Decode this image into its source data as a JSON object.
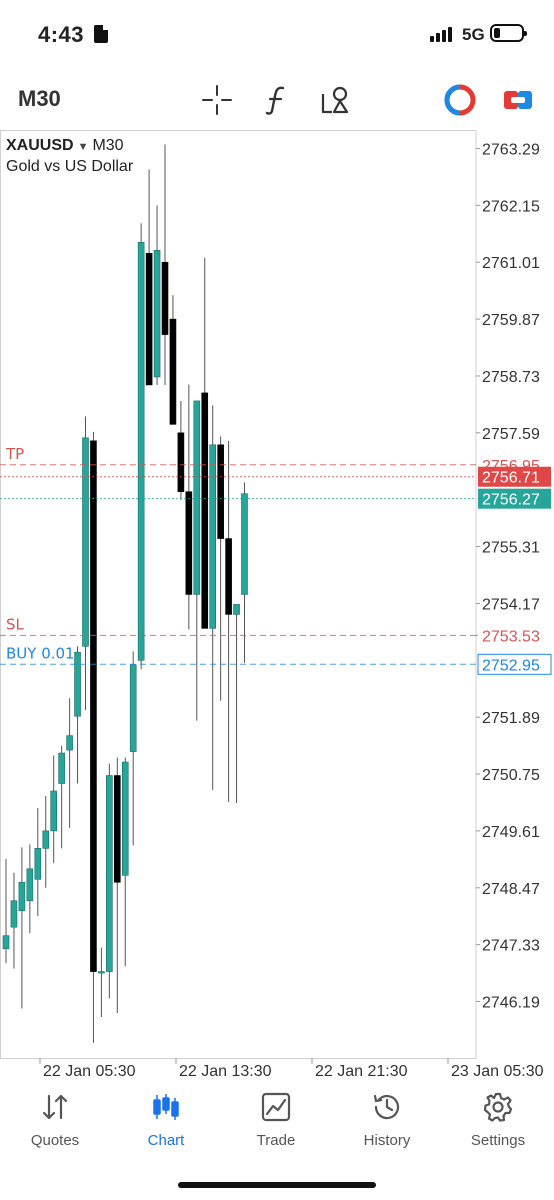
{
  "status_bar": {
    "time": "4:43",
    "network": "5G"
  },
  "toolbar": {
    "timeframe": "M30",
    "icons": [
      "crosshair-icon",
      "function-icon",
      "objects-icon",
      "one-click-trading-icon",
      "trade-panel-icon"
    ]
  },
  "chart": {
    "symbol": "XAUUSD",
    "timeframe": "M30",
    "description": "Gold vs US Dollar",
    "price_levels": [
      {
        "label": "TP",
        "price": "2756.95",
        "color": "#d9534f"
      },
      {
        "label": "",
        "price": "2756.71",
        "color": "#e04848"
      },
      {
        "label": "",
        "price": "2756.27",
        "color": "#26a69a"
      },
      {
        "label": "SL",
        "price": "2753.53",
        "color": "#d9534f"
      },
      {
        "label": "BUY 0.01",
        "price": "2752.95",
        "color": "#1e88e5"
      }
    ],
    "colors": {
      "bull": "#26a69a",
      "bear": "#000000",
      "tp_sl": "#d9534f",
      "bid": "#e04848",
      "ask": "#26a69a",
      "buy": "#1e88e5"
    }
  },
  "chart_data": {
    "type": "candlestick",
    "title": "XAUUSD M30",
    "subtitle": "Gold vs US Dollar",
    "y_ticks": [
      2763.29,
      2762.15,
      2761.01,
      2759.87,
      2758.73,
      2757.59,
      2755.31,
      2754.17,
      2753.53,
      2751.89,
      2750.75,
      2749.61,
      2748.47,
      2747.33,
      2746.19
    ],
    "y_tick_labels": [
      "2763.29",
      "2762.15",
      "2761.01",
      "2759.87",
      "2758.73",
      "2757.59",
      "2755.31",
      "2754.17",
      "2753.53",
      "2751.89",
      "2750.75",
      "2749.61",
      "2748.47",
      "2747.33",
      "2746.19"
    ],
    "ylim": [
      2745.25,
      2763.5
    ],
    "x_tick_labels": [
      "22 Jan 05:30",
      "22 Jan 13:30",
      "22 Jan 21:30",
      "23 Jan 05:30"
    ],
    "candles": [
      {
        "o": 2747.25,
        "h": 2749.05,
        "l": 2746.96,
        "c": 2747.51
      },
      {
        "o": 2747.68,
        "h": 2748.77,
        "l": 2746.85,
        "c": 2748.21
      },
      {
        "o": 2748.01,
        "h": 2749.28,
        "l": 2746.05,
        "c": 2748.58
      },
      {
        "o": 2748.21,
        "h": 2749.34,
        "l": 2747.56,
        "c": 2748.85
      },
      {
        "o": 2748.64,
        "h": 2750.07,
        "l": 2747.9,
        "c": 2749.26
      },
      {
        "o": 2749.26,
        "h": 2750.31,
        "l": 2748.47,
        "c": 2749.61
      },
      {
        "o": 2749.61,
        "h": 2751.12,
        "l": 2748.96,
        "c": 2750.41
      },
      {
        "o": 2750.56,
        "h": 2751.32,
        "l": 2749.26,
        "c": 2751.17
      },
      {
        "o": 2751.23,
        "h": 2752.27,
        "l": 2749.67,
        "c": 2751.52
      },
      {
        "o": 2751.91,
        "h": 2753.31,
        "l": 2750.56,
        "c": 2753.19
      },
      {
        "o": 2753.31,
        "h": 2757.92,
        "l": 2752.03,
        "c": 2757.49
      },
      {
        "o": 2757.43,
        "h": 2757.61,
        "l": 2745.36,
        "c": 2746.79
      },
      {
        "o": 2746.79,
        "h": 2747.27,
        "l": 2745.88,
        "c": 2746.79
      },
      {
        "o": 2746.79,
        "h": 2750.96,
        "l": 2746.25,
        "c": 2750.72
      },
      {
        "o": 2750.72,
        "h": 2751.08,
        "l": 2745.96,
        "c": 2748.58
      },
      {
        "o": 2748.72,
        "h": 2751.08,
        "l": 2746.9,
        "c": 2750.99
      },
      {
        "o": 2751.2,
        "h": 2753.21,
        "l": 2749.32,
        "c": 2752.94
      },
      {
        "o": 2753.03,
        "h": 2761.79,
        "l": 2752.85,
        "c": 2761.41
      },
      {
        "o": 2761.19,
        "h": 2762.87,
        "l": 2758.55,
        "c": 2758.55
      },
      {
        "o": 2758.71,
        "h": 2762.15,
        "l": 2758.55,
        "c": 2761.25
      },
      {
        "o": 2761.01,
        "h": 2763.37,
        "l": 2758.55,
        "c": 2759.56
      },
      {
        "o": 2759.87,
        "h": 2760.35,
        "l": 2757.76,
        "c": 2757.76
      },
      {
        "o": 2757.59,
        "h": 2758.23,
        "l": 2756.25,
        "c": 2756.41
      },
      {
        "o": 2756.41,
        "h": 2758.56,
        "l": 2753.65,
        "c": 2754.35
      },
      {
        "o": 2754.35,
        "h": 2758.23,
        "l": 2751.82,
        "c": 2758.23
      },
      {
        "o": 2758.39,
        "h": 2761.1,
        "l": 2753.74,
        "c": 2753.67
      },
      {
        "o": 2753.67,
        "h": 2758.14,
        "l": 2750.43,
        "c": 2757.35
      },
      {
        "o": 2757.35,
        "h": 2757.52,
        "l": 2752.22,
        "c": 2755.47
      },
      {
        "o": 2755.47,
        "h": 2757.43,
        "l": 2750.19,
        "c": 2753.95
      },
      {
        "o": 2753.95,
        "h": 2754.05,
        "l": 2750.17,
        "c": 2754.15
      },
      {
        "o": 2754.35,
        "h": 2756.6,
        "l": 2752.98,
        "c": 2756.37
      }
    ],
    "grid": false,
    "legend": "none"
  },
  "nav": {
    "items": [
      {
        "label": "Quotes",
        "icon": "quotes-icon"
      },
      {
        "label": "Chart",
        "icon": "chart-icon"
      },
      {
        "label": "Trade",
        "icon": "trade-icon"
      },
      {
        "label": "History",
        "icon": "history-icon"
      },
      {
        "label": "Settings",
        "icon": "settings-icon"
      }
    ],
    "active": "Chart",
    "active_color": "#1a73e8"
  }
}
